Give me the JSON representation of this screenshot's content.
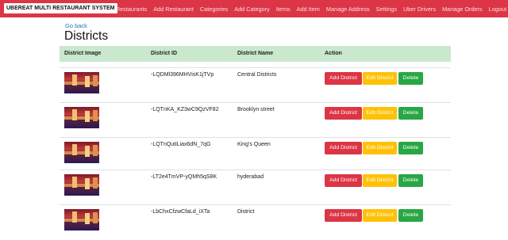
{
  "brand": "UBEREAT MULTI RESTAURANT SYSTEM",
  "nav": [
    "Restaurants",
    "Add Restaurant",
    "Categories",
    "Add Category",
    "Items",
    "Add Item",
    "Manage Address",
    "Settings",
    "Uber Drivers",
    "Manage Orders",
    "Logout"
  ],
  "back_link": "Go back",
  "page_title": "Districts",
  "columns": [
    "District Image",
    "District ID",
    "District Name",
    "Action"
  ],
  "actions": {
    "add": "Add District",
    "edit": "Edit District",
    "delete": "Delete"
  },
  "rows": [
    {
      "id": "-LQDMl396MHVisK1jTVp",
      "name": "Central Districts"
    },
    {
      "id": "-LQTnKA_KZ3wC9QzVF82",
      "name": "Brooklyn street"
    },
    {
      "id": "-LQTnQutiLiax6dN_7qG",
      "name": "King's Queen"
    },
    {
      "id": "-LT2e4TmVP-yQMh5qS8K",
      "name": "hyderabad"
    },
    {
      "id": "-LbChxCfzwCfaLd_iXTa",
      "name": "District"
    }
  ],
  "colors": {
    "navbar": "#dc3545",
    "header_row": "#c9e8cd",
    "add": "#dc3545",
    "edit": "#ffc107",
    "delete": "#28a745"
  }
}
